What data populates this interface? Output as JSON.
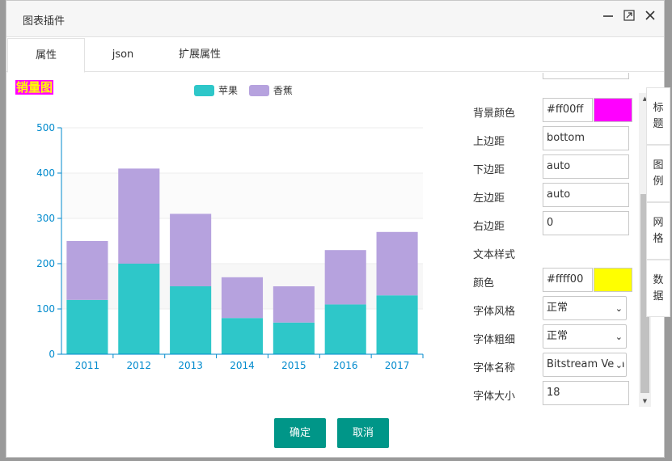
{
  "dialog": {
    "title": "图表插件",
    "minimize_icon": "minimize-icon",
    "maximize_icon": "maximize-icon",
    "close_icon": "close-icon"
  },
  "tabs": [
    {
      "label": "属性",
      "active": true
    },
    {
      "label": "json",
      "active": false
    },
    {
      "label": "扩展属性",
      "active": false
    }
  ],
  "chart_data": {
    "type": "bar",
    "stacked": true,
    "title": "销量图",
    "categories": [
      "2011",
      "2012",
      "2013",
      "2014",
      "2015",
      "2016",
      "2017"
    ],
    "series": [
      {
        "name": "苹果",
        "values": [
          120,
          200,
          150,
          80,
          70,
          110,
          130
        ],
        "color": "#2ec7c9"
      },
      {
        "name": "香蕉",
        "values": [
          130,
          210,
          160,
          90,
          80,
          120,
          140
        ],
        "color": "#b6a2de"
      }
    ],
    "ylim": [
      0,
      500
    ],
    "yticks": [
      "0",
      "100",
      "200",
      "300",
      "400",
      "500"
    ],
    "title_color": "#ffff00",
    "title_background": "#ff00ff",
    "axis_color": "#008acd"
  },
  "properties": {
    "background_color": {
      "label": "背景颜色",
      "value": "#ff00ff",
      "swatch": "#ff00ff"
    },
    "top_margin": {
      "label": "上边距",
      "value": "bottom"
    },
    "bottom_margin": {
      "label": "下边距",
      "value": "auto"
    },
    "left_margin": {
      "label": "左边距",
      "value": "auto"
    },
    "right_margin": {
      "label": "右边距",
      "value": "0"
    },
    "text_style": {
      "label": "文本样式"
    },
    "color": {
      "label": "颜色",
      "value": "#ffff00",
      "swatch": "#ffff00"
    },
    "font_style": {
      "label": "字体风格",
      "value": "正常"
    },
    "font_weight": {
      "label": "字体粗细",
      "value": "正常"
    },
    "font_family": {
      "label": "字体名称",
      "value": "Bitstream Vera"
    },
    "font_size": {
      "label": "字体大小",
      "value": "18"
    }
  },
  "side_tabs": [
    {
      "label": "标题"
    },
    {
      "label": "图例"
    },
    {
      "label": "网格"
    },
    {
      "label": "数据"
    }
  ],
  "buttons": {
    "confirm": "确定",
    "cancel": "取消"
  }
}
